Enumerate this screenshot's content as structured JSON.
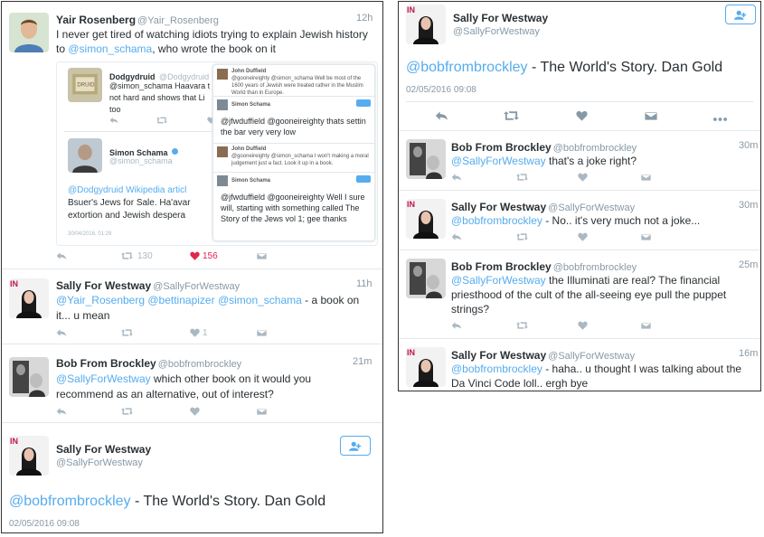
{
  "left": {
    "tweet1": {
      "name": "Yair Rosenberg",
      "handle": "@Yair_Rosenberg",
      "time": "12h",
      "text": "I never get tired of watching idiots trying to explain Jewish history to @simon_schama, who wrote the book on it",
      "quote1": {
        "name": "Dodgydruid",
        "handle": "@Dodgydruid",
        "text1": "@simon_schama Haavara t",
        "text2": "not hard and shows that Li",
        "text3": "too"
      },
      "quote2": {
        "name": "Simon Schama",
        "handle": "@simon_schama",
        "text1": "@Dodgydruid Wikipedia articl",
        "text2": "Bsuer's Jews for Sale. Ha'avar",
        "text3": "extortion and Jewish despera",
        "date": "30/04/2016, 01:29"
      },
      "inner1": {
        "name": "John Duffield",
        "text": "@gooneireighty @simon_schama Well be most of the 1600 years of Jewish were treated rather in the Muslim World than in Europe."
      },
      "inner2": {
        "name": "Simon Schama",
        "text": "@jfwduffield @gooneireighty thats settin the bar very very low"
      },
      "inner3": {
        "name": "John Duffield",
        "text": "@gooneireighty @simon_schama I won't making a moral judgement just a fact. Look it up in a book."
      },
      "inner4": {
        "name": "Simon Schama",
        "text": "@jfwduffield @gooneireighty Well I sure will, starting with something called The Story of the Jews vol 1; gee thanks"
      },
      "follow": "Follow",
      "retweets": "130",
      "likes": "156"
    },
    "tweet2": {
      "name": "Sally For Westway",
      "handle": "@SallyForWestway",
      "time": "11h",
      "text1": "@Yair_Rosenberg @bettinapizer @simon_schama - a book on",
      "text2": "it... u mean",
      "likes": "1"
    },
    "tweet3": {
      "name": "Bob From Brockley",
      "handle": "@bobfrombrockley",
      "time": "21m",
      "text1": "@SallyForWestway which other book on it would you",
      "text2": "recommend as an alternative, out of interest?"
    },
    "main": {
      "name": "Sally For Westway",
      "handle": "@SallyForWestway",
      "mention": "@bobfrombrockley",
      "text": " - The World's Story. Dan Gold",
      "date": "02/05/2016 09:08"
    }
  },
  "right": {
    "main": {
      "name": "Sally For Westway",
      "handle": "@SallyForWestway",
      "mention": "@bobfrombrockley",
      "text": " - The World's Story. Dan Gold",
      "date": "02/05/2016 09:08"
    },
    "replies": [
      {
        "name": "Bob From Brockley",
        "handle": "@bobfrombrockley",
        "time": "30m",
        "text1": "@SallyForWestway that's a joke right?",
        "text2": "",
        "text3": ""
      },
      {
        "name": "Sally For Westway",
        "handle": "@SallyForWestway",
        "time": "30m",
        "text1": "@bobfrombrockley - No.. it's very much not a joke...",
        "text2": "",
        "text3": ""
      },
      {
        "name": "Bob From Brockley",
        "handle": "@bobfrombrockley",
        "time": "25m",
        "text1": "@SallyForWestway the Illuminati are real? The financial",
        "text2": "priesthood of the cult of the all-seeing eye pull the puppet",
        "text3": "strings?"
      },
      {
        "name": "Sally For Westway",
        "handle": "@SallyForWestway",
        "time": "16m",
        "text1": "@bobfrombrockley - haha.. u thought I was talking about the",
        "text2": "Da Vinci Code loll.. ergh bye",
        "text3": ""
      }
    ]
  },
  "icons": {
    "reply": "reply-icon",
    "retweet": "retweet-icon",
    "like": "heart-icon",
    "dm": "envelope-icon",
    "more": "more-icon",
    "follow": "add-user-icon"
  },
  "colors": {
    "link": "#55acee",
    "heart": "#e2264d",
    "muted": "#8899a6"
  }
}
